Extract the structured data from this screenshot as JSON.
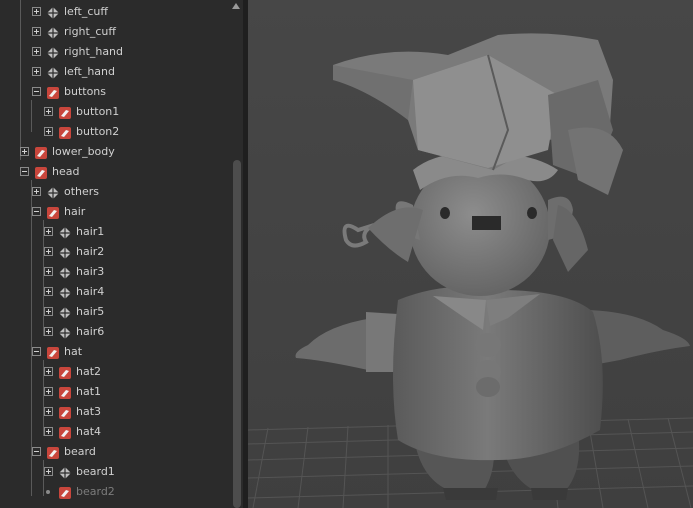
{
  "outliner": {
    "items": [
      {
        "label": "left_cuff",
        "type": "mesh",
        "expander": "plus"
      },
      {
        "label": "right_cuff",
        "type": "mesh",
        "expander": "plus"
      },
      {
        "label": "right_hand",
        "type": "mesh",
        "expander": "plus"
      },
      {
        "label": "left_hand",
        "type": "mesh",
        "expander": "plus"
      },
      {
        "label": "buttons",
        "type": "group",
        "expander": "minus"
      },
      {
        "label": "button1",
        "type": "group",
        "expander": "plus"
      },
      {
        "label": "button2",
        "type": "group",
        "expander": "plus"
      },
      {
        "label": "lower_body",
        "type": "group",
        "expander": "plus"
      },
      {
        "label": "head",
        "type": "group",
        "expander": "minus"
      },
      {
        "label": "others",
        "type": "mesh",
        "expander": "plus"
      },
      {
        "label": "hair",
        "type": "group",
        "expander": "minus"
      },
      {
        "label": "hair1",
        "type": "mesh",
        "expander": "plus"
      },
      {
        "label": "hair2",
        "type": "mesh",
        "expander": "plus"
      },
      {
        "label": "hair3",
        "type": "mesh",
        "expander": "plus"
      },
      {
        "label": "hair4",
        "type": "mesh",
        "expander": "plus"
      },
      {
        "label": "hair5",
        "type": "mesh",
        "expander": "plus"
      },
      {
        "label": "hair6",
        "type": "mesh",
        "expander": "plus"
      },
      {
        "label": "hat",
        "type": "group",
        "expander": "minus"
      },
      {
        "label": "hat2",
        "type": "group",
        "expander": "plus"
      },
      {
        "label": "hat1",
        "type": "group",
        "expander": "plus"
      },
      {
        "label": "hat3",
        "type": "group",
        "expander": "plus"
      },
      {
        "label": "hat4",
        "type": "group",
        "expander": "plus"
      },
      {
        "label": "beard",
        "type": "group",
        "expander": "minus"
      },
      {
        "label": "beard1",
        "type": "mesh",
        "expander": "plus"
      },
      {
        "label": "beard2",
        "type": "group",
        "expander": "none",
        "dim": true
      }
    ]
  },
  "icons": {
    "mesh": "mesh-shape-icon",
    "group": "transform-group-icon",
    "scroll_up": "scroll-up-arrow-icon"
  },
  "colors": {
    "outliner_bg": "#2b2b2b",
    "viewport_bg": "#454545",
    "text": "#d0d0d0",
    "group_icon_red": "#c8463c"
  }
}
